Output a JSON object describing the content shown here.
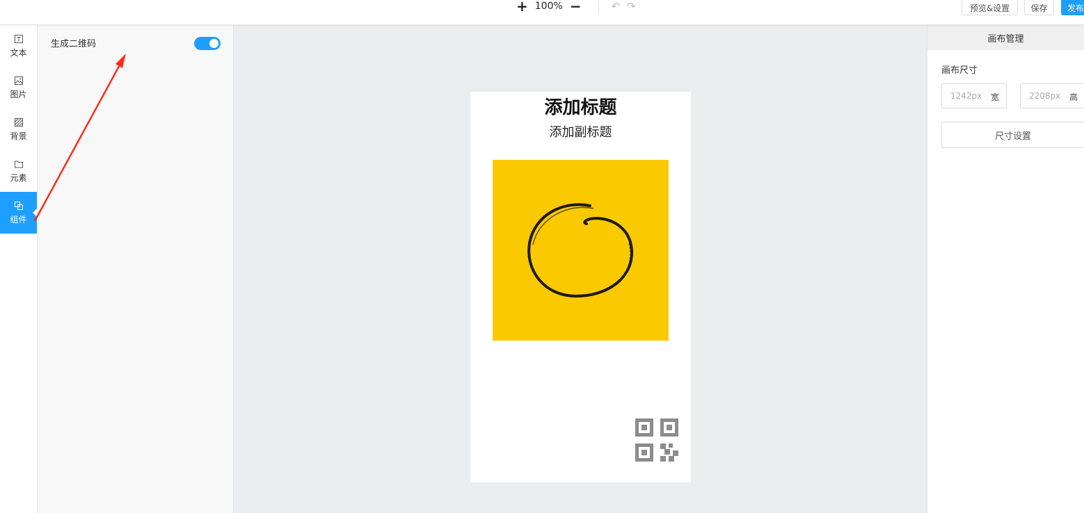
{
  "toolbar": {
    "zoom_in": "+",
    "zoom_level": "100%",
    "zoom_out": "−",
    "undo": "↶",
    "redo": "↷",
    "preview_label": "预览&设置",
    "save_label": "保存",
    "publish_label": "发布"
  },
  "nav": {
    "items": [
      {
        "label": "文本",
        "icon": "text-icon"
      },
      {
        "label": "图片",
        "icon": "image-icon"
      },
      {
        "label": "背景",
        "icon": "background-icon"
      },
      {
        "label": "元素",
        "icon": "folder-icon"
      },
      {
        "label": "组件",
        "icon": "component-icon",
        "active": true
      }
    ]
  },
  "panel": {
    "qrcode_label": "生成二维码",
    "qrcode_enabled": true
  },
  "canvas": {
    "title": "添加标题",
    "subtitle": "添加副标题",
    "image_color": "#fbc900"
  },
  "right_panel": {
    "tab": "画布管理",
    "size_label": "画布尺寸",
    "width_placeholder": "1242px",
    "width_unit": "宽",
    "height_placeholder": "2208px",
    "height_unit": "高",
    "size_button": "尺寸设置"
  },
  "colors": {
    "accent": "#1e9fff",
    "annotation_arrow": "#ff2a1a"
  }
}
